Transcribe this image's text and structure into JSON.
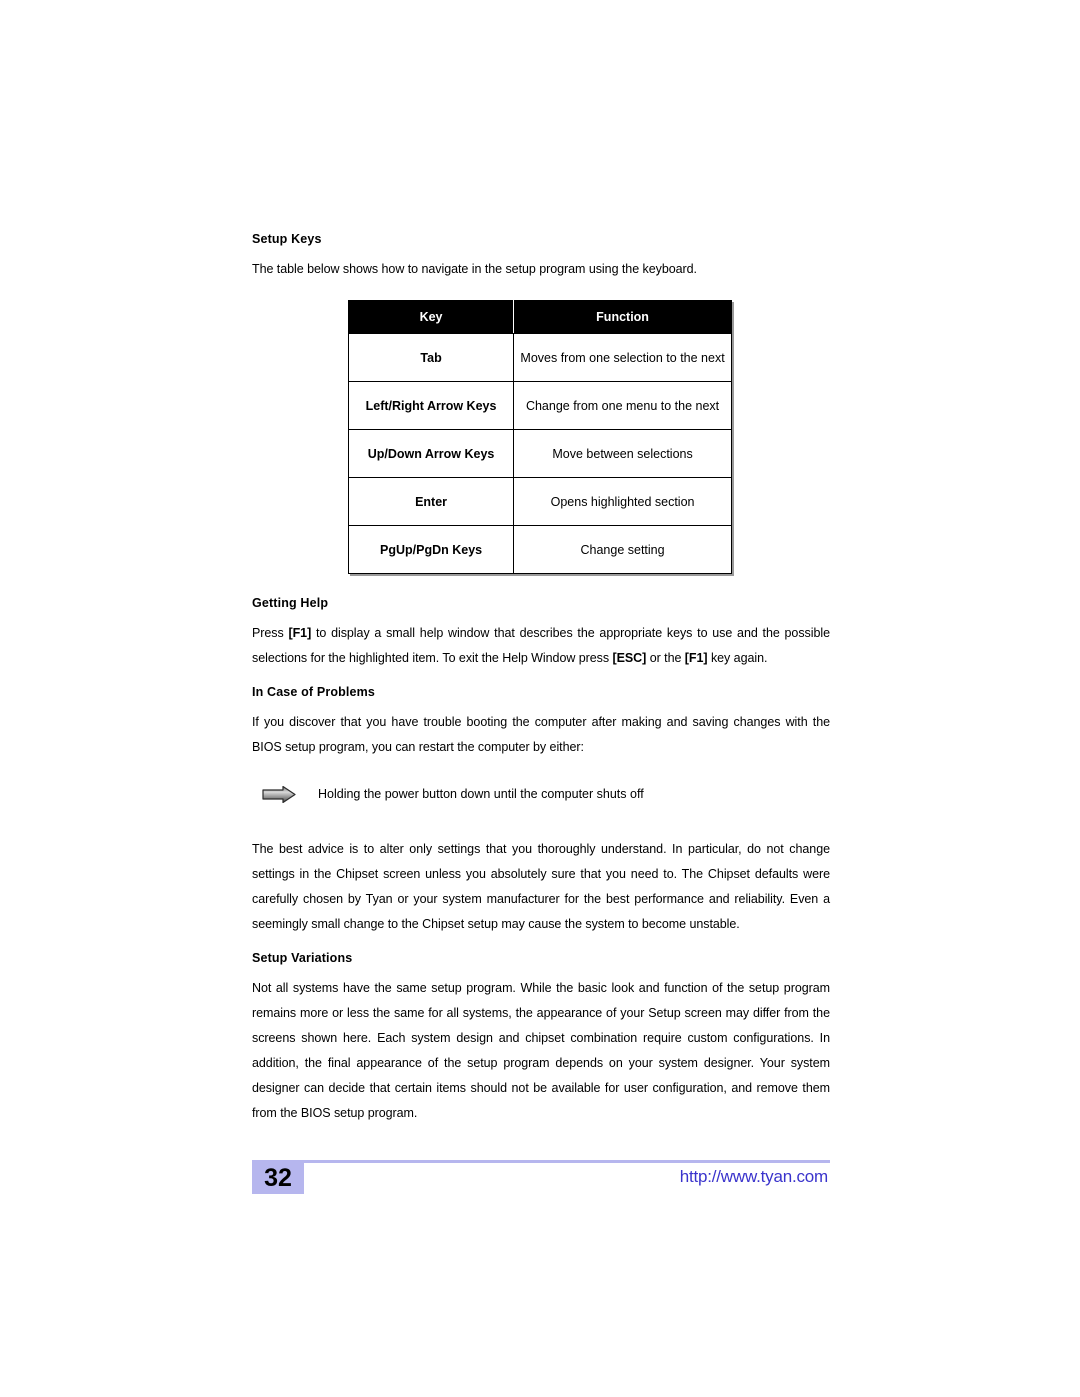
{
  "document": {
    "sections": {
      "setup_keys": {
        "heading": "Setup Keys",
        "intro": "The table below shows how to navigate in the setup program using the keyboard."
      },
      "getting_help": {
        "heading": "Getting Help",
        "paragraph_part1": "Press ",
        "key_f1_a": "[F1]",
        "paragraph_part2": " to display a small help window that describes the appropriate keys to use and the possible selections for the highlighted item. To exit the Help Window press ",
        "key_esc": "[ESC]",
        "paragraph_part3": " or the ",
        "key_f1_b": "[F1]",
        "paragraph_part4": " key again."
      },
      "in_case_of_problems": {
        "heading": "In Case of Problems",
        "paragraph": "If you discover that you have trouble booting the computer after making and saving changes with the BIOS setup program, you can restart the computer by either:",
        "bullet_icon": "right-arrow-icon",
        "bullet_text": "Holding the power button down until the computer shuts off",
        "advice_paragraph": "The best advice is to alter only settings that you thoroughly understand. In particular, do not change settings in the Chipset screen unless you absolutely sure that you need to. The Chipset defaults were carefully chosen by Tyan or your system manufacturer for the best performance and reliability. Even a seemingly small change to the Chipset setup may cause the system to become unstable."
      },
      "setup_variations": {
        "heading": "Setup Variations",
        "paragraph": "Not all systems have the same setup program. While the basic look and function of the setup program remains more or less the same for all systems, the appearance of your Setup screen may differ from the screens shown here. Each system design and chipset combination require custom configurations. In addition, the final appearance of the setup program depends on your system designer. Your system designer can decide that certain items should not be available for user configuration, and remove them from the BIOS setup program."
      }
    },
    "keys_table": {
      "headers": [
        "Key",
        "Function"
      ],
      "rows": [
        {
          "key": "Tab",
          "function": "Moves from one selection to the next"
        },
        {
          "key": "Left/Right Arrow Keys",
          "function": "Change from one menu to the next"
        },
        {
          "key": "Up/Down Arrow Keys",
          "function": "Move between selections"
        },
        {
          "key": "Enter",
          "function": "Opens highlighted section"
        },
        {
          "key": "PgUp/PgDn Keys",
          "function": "Change setting"
        }
      ]
    },
    "footer": {
      "page_number": "32",
      "url": "http://www.tyan.com"
    },
    "colors": {
      "accent_highlight": "#b6b6ee",
      "url_text": "#3a33cc",
      "table_header_bg": "#000000",
      "body_text": "#000000"
    }
  }
}
